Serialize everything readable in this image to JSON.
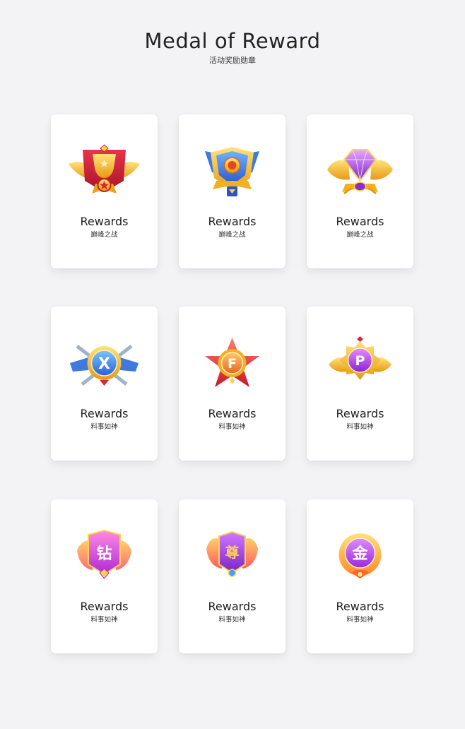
{
  "header": {
    "title": "Medal of Reward",
    "subtitle": "活动奖励勋章"
  },
  "cards": [
    {
      "title": "Rewards",
      "subtitle": "巅峰之战",
      "icon": "trophy-winged-medal-icon",
      "colors": {
        "main": "#f5b92a",
        "accent": "#d8263a"
      }
    },
    {
      "title": "Rewards",
      "subtitle": "巅峰之战",
      "icon": "blue-shield-medal-icon",
      "colors": {
        "main": "#f2b021",
        "accent": "#3a6fd8"
      }
    },
    {
      "title": "Rewards",
      "subtitle": "巅峰之战",
      "icon": "purple-gem-medal-icon",
      "colors": {
        "main": "#f5b92a",
        "accent": "#a23cdc"
      }
    },
    {
      "title": "Rewards",
      "subtitle": "料事如神",
      "icon": "x-swords-medal-icon",
      "colors": {
        "main": "#f2b021",
        "accent": "#2f7be6"
      }
    },
    {
      "title": "Rewards",
      "subtitle": "料事如神",
      "icon": "f-star-medal-icon",
      "colors": {
        "main": "#f08a2a",
        "accent": "#d8263a"
      }
    },
    {
      "title": "Rewards",
      "subtitle": "料事如神",
      "icon": "p-sun-medal-icon",
      "colors": {
        "main": "#f5b92a",
        "accent": "#b03ee0"
      }
    },
    {
      "title": "Rewards",
      "subtitle": "料事如神",
      "icon": "diamond-char-medal-icon",
      "colors": {
        "main": "#ff9a3c",
        "accent": "#e04ac8"
      }
    },
    {
      "title": "Rewards",
      "subtitle": "料事如神",
      "icon": "honor-char-medal-icon",
      "colors": {
        "main": "#ff8a3c",
        "accent": "#b03ee0"
      }
    },
    {
      "title": "Rewards",
      "subtitle": "料事如神",
      "icon": "gold-char-medal-icon",
      "colors": {
        "main": "#ffb13a",
        "accent": "#b847e0"
      }
    }
  ],
  "medal_glyphs": [
    "X",
    "F",
    "P",
    "钻",
    "尊",
    "金"
  ]
}
